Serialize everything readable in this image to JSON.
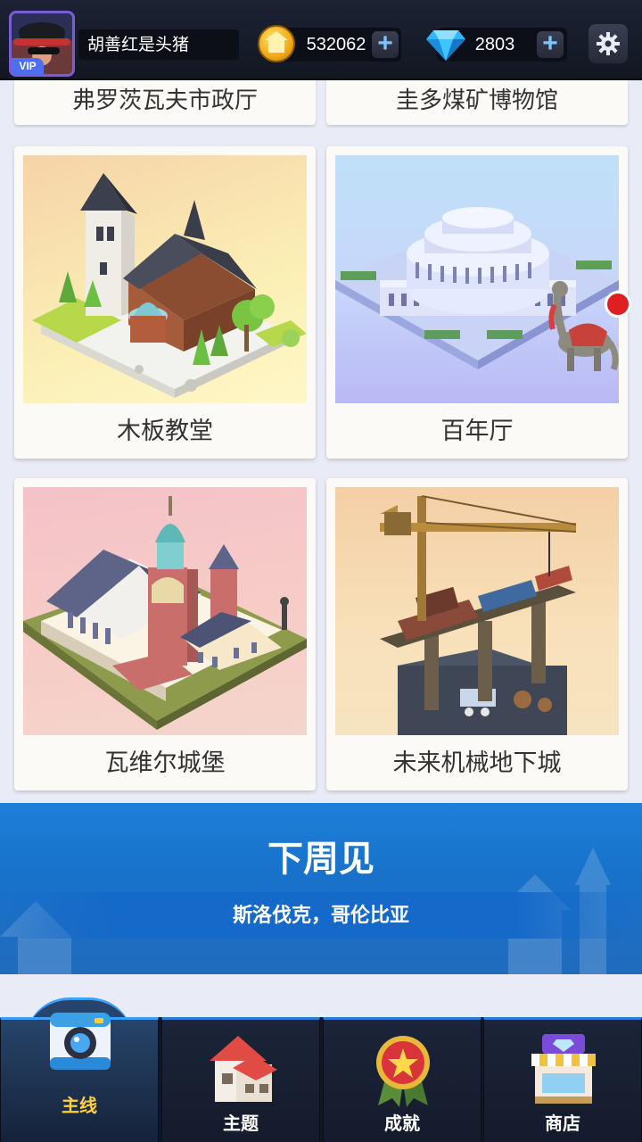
{
  "header": {
    "username": "胡善红是头猪",
    "vip_label": "VIP",
    "coins": "532062",
    "gems": "2803",
    "plus_symbol": "+"
  },
  "cards_partial": [
    {
      "title": "弗罗茨瓦夫市政厅"
    },
    {
      "title": "圭多煤矿博物馆"
    }
  ],
  "cards": [
    {
      "title": "木板教堂",
      "icon": "wooden-church-illustration"
    },
    {
      "title": "百年厅",
      "icon": "centennial-hall-illustration",
      "has_notification": true
    },
    {
      "title": "瓦维尔城堡",
      "icon": "wawel-castle-illustration"
    },
    {
      "title": "未来机械地下城",
      "icon": "future-mechanical-underground-illustration"
    }
  ],
  "banner": {
    "title": "下周见",
    "subtitle": "斯洛伐克，哥伦比亚"
  },
  "nav": {
    "items": [
      {
        "label": "主线",
        "icon": "camera-icon",
        "active": true
      },
      {
        "label": "主题",
        "icon": "house-icon",
        "active": false
      },
      {
        "label": "成就",
        "icon": "medal-icon",
        "active": false
      },
      {
        "label": "商店",
        "icon": "shop-icon",
        "active": false
      }
    ]
  },
  "colors": {
    "accent": "#1e7fd8",
    "active_nav_label": "#ffd23a",
    "notification": "#e02020"
  }
}
